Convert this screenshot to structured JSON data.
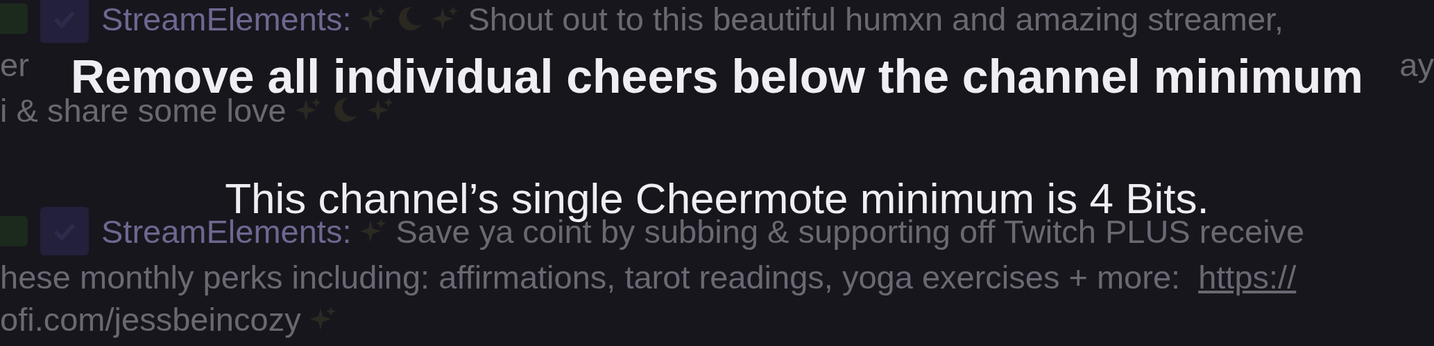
{
  "chat": {
    "messages": [
      {
        "badges": [
          {
            "kind": "partial"
          },
          {
            "kind": "verified"
          }
        ],
        "lines": [
          [
            {
              "kind": "author",
              "text": "StreamElements:"
            },
            {
              "kind": "sparkle"
            },
            {
              "kind": "moon"
            },
            {
              "kind": "sparkle"
            },
            {
              "kind": "text",
              "text": "Shout out to this beautiful humxn and amazing streamer,"
            }
          ],
          [
            {
              "kind": "text",
              "text": "er"
            },
            {
              "kind": "covered"
            },
            {
              "kind": "text",
              "text": "ay"
            }
          ],
          [
            {
              "kind": "text",
              "text": "i & share some love"
            },
            {
              "kind": "sparkle"
            },
            {
              "kind": "moon"
            },
            {
              "kind": "sparkle"
            }
          ]
        ]
      },
      {
        "badges": [
          {
            "kind": "partial"
          },
          {
            "kind": "verified"
          }
        ],
        "lines": [
          [
            {
              "kind": "author",
              "text": "StreamElements:"
            },
            {
              "kind": "sparkle"
            },
            {
              "kind": "text",
              "text": "Save ya coint by subbing & supporting off Twitch PLUS receive"
            }
          ],
          [
            {
              "kind": "text",
              "text": "hese monthly perks including: affirmations, tarot readings, yoga exercises + more:"
            },
            {
              "kind": "link",
              "text": "https://"
            }
          ],
          [
            {
              "kind": "text",
              "text": "ofi.com/jessbeincozy"
            },
            {
              "kind": "sparkle"
            }
          ]
        ]
      }
    ]
  },
  "dialog": {
    "title": "Remove all individual cheers below the channel minimum",
    "message": "This channel’s single Cheermote minimum is 4 Bits."
  }
}
